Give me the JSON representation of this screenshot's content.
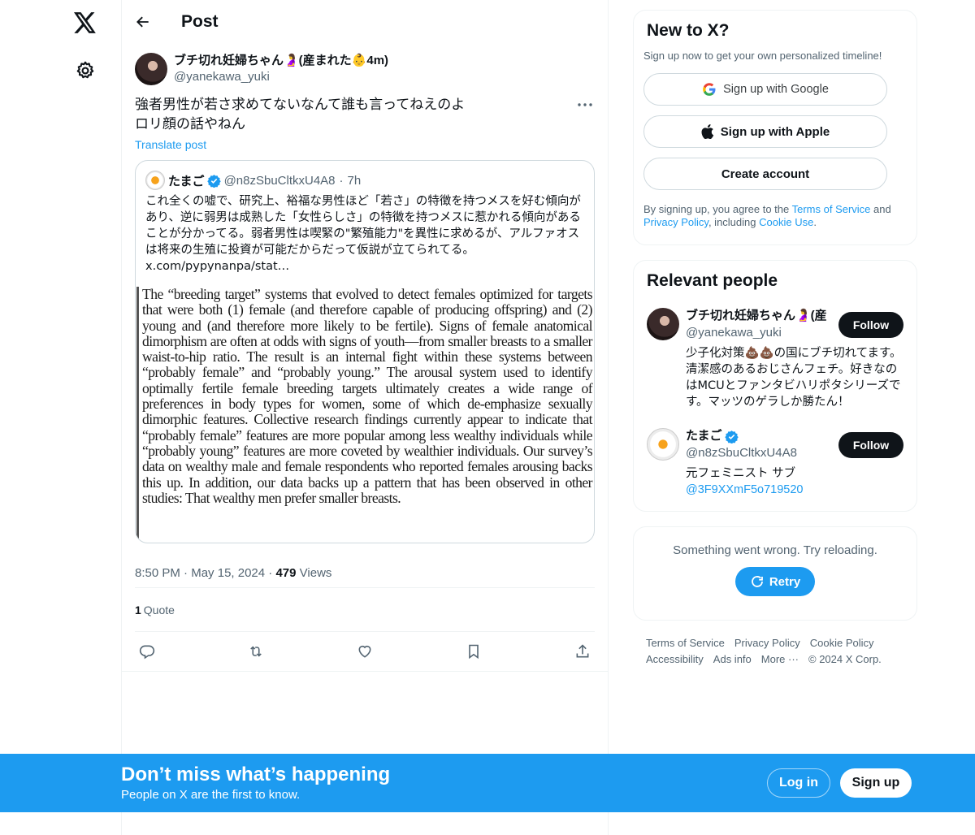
{
  "nav": {
    "logo_icon": "x-logo-icon",
    "settings_icon": "gear-icon"
  },
  "header": {
    "title": "Post",
    "back_icon": "arrow-left-icon"
  },
  "post": {
    "author_name": "ブチ切れ妊婦ちゃん🤰(産まれた👶4m)",
    "author_handle": "@yanekawa_yuki",
    "text_lines": [
      "強者男性が若さ求めてないなんて誰も言ってねえのよ",
      "ロリ顔の話やねん"
    ],
    "translate_label": "Translate post",
    "time": "8:50 PM",
    "date": "May 15, 2024",
    "views_count": "479",
    "views_label": "Views",
    "quotes_count": "1",
    "quotes_label": "Quote",
    "meta_sep": "·"
  },
  "quote": {
    "name": "たまご",
    "handle": "@n8zSbuCltkxU4A8",
    "time": "7h",
    "text": "これ全くの嘘で、研究上、裕福な男性ほど「若さ」の特徴を持つメスを好む傾向があり、逆に弱男は成熟した「女性らしさ」の特徴を持つメスに惹かれる傾向があることが分かってる。弱者男性は喫緊の\"繁殖能力\"を異性に求めるが、アルファオスは将来の生殖に投資が可能だからだって仮説が立てられてる。",
    "link": "x.com/pypynanpa/stat…",
    "image_text": "The “breeding target” systems that evolved to detect females optimized for targets that were both (1) female (and therefore capable of producing offspring) and (2) young and (and therefore more likely to be fertile). Signs of female anatomical dimorphism are often at odds with signs of youth—from smaller breasts to a smaller waist-to-hip ratio. The result is an internal fight within these systems between “probably female” and “probably young.” The arousal system used to identify optimally fertile female breeding targets ultimately creates a wide range of preferences in body types for women, some of which de-emphasize sexually dimorphic features. Collective research findings currently appear to indicate that “probably female” features are more popular among less wealthy individuals while “probably young” features are more coveted by wealthier individuals. Our survey’s data on wealthy male and female respondents who reported females arousing backs this up. In addition, our data backs up a pattern that has been observed in other studies: That wealthy men prefer smaller breasts."
  },
  "signup": {
    "title": "New to X?",
    "subtitle": "Sign up now to get your own personalized timeline!",
    "google_label": "Sign up with Google",
    "apple_label": "Sign up with Apple",
    "create_label": "Create account",
    "legal_1": "By signing up, you agree to the ",
    "terms_link": "Terms of Service",
    "legal_2": " and ",
    "privacy_link": "Privacy Policy",
    "legal_3": ", including ",
    "cookie_link": "Cookie Use",
    "legal_4": "."
  },
  "people": {
    "title": "Relevant people",
    "follow_label": "Follow",
    "items": [
      {
        "name": "ブチ切れ妊婦ちゃん🤰(産",
        "handle": "@yanekawa_yuki",
        "bio": "少子化対策💩💩の国にブチ切れてます。清潔感のあるおじさんフェチ。好きなのはMCUとファンタビハリポタシリーズです。マッツのゲラしか勝たん！"
      },
      {
        "name": "たまご",
        "handle": "@n8zSbuCltkxU4A8",
        "bio": "元フェミニスト サブ",
        "bio_link": "@3F9XXmF5o719520"
      }
    ]
  },
  "error": {
    "text": "Something went wrong. Try reloading.",
    "retry_label": "Retry"
  },
  "footer": {
    "links": [
      "Terms of Service",
      "Privacy Policy",
      "Cookie Policy",
      "Accessibility",
      "Ads info",
      "More ···",
      "© 2024 X Corp."
    ]
  },
  "banner": {
    "title": "Don’t miss what’s happening",
    "subtitle": "People on X are the first to know.",
    "login_label": "Log in",
    "signup_label": "Sign up"
  },
  "colors": {
    "accent": "#1d9bf0",
    "text": "#0f1419",
    "secondary": "#536471",
    "border": "#eff3f4"
  }
}
